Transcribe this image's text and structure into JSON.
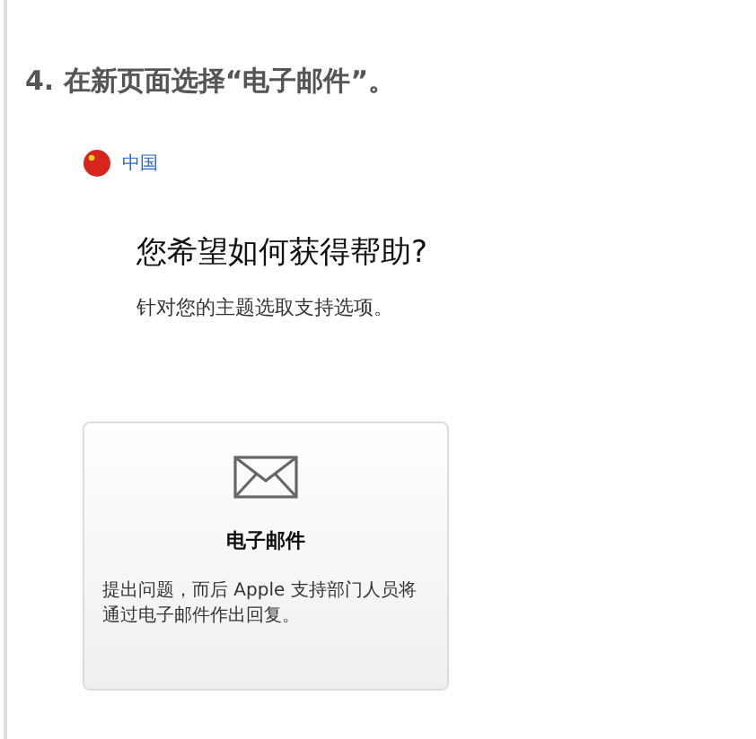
{
  "heading": "4. 在新页面选择“电子邮件”。",
  "region": {
    "label": "中国"
  },
  "title": "您希望如何获得帮助?",
  "subtitle": "针对您的主题选取支持选项。",
  "options": [
    {
      "title": "电子邮件",
      "description": "提出问题，而后 Apple 支持部门人员将通过电子邮件作出回复。"
    }
  ]
}
